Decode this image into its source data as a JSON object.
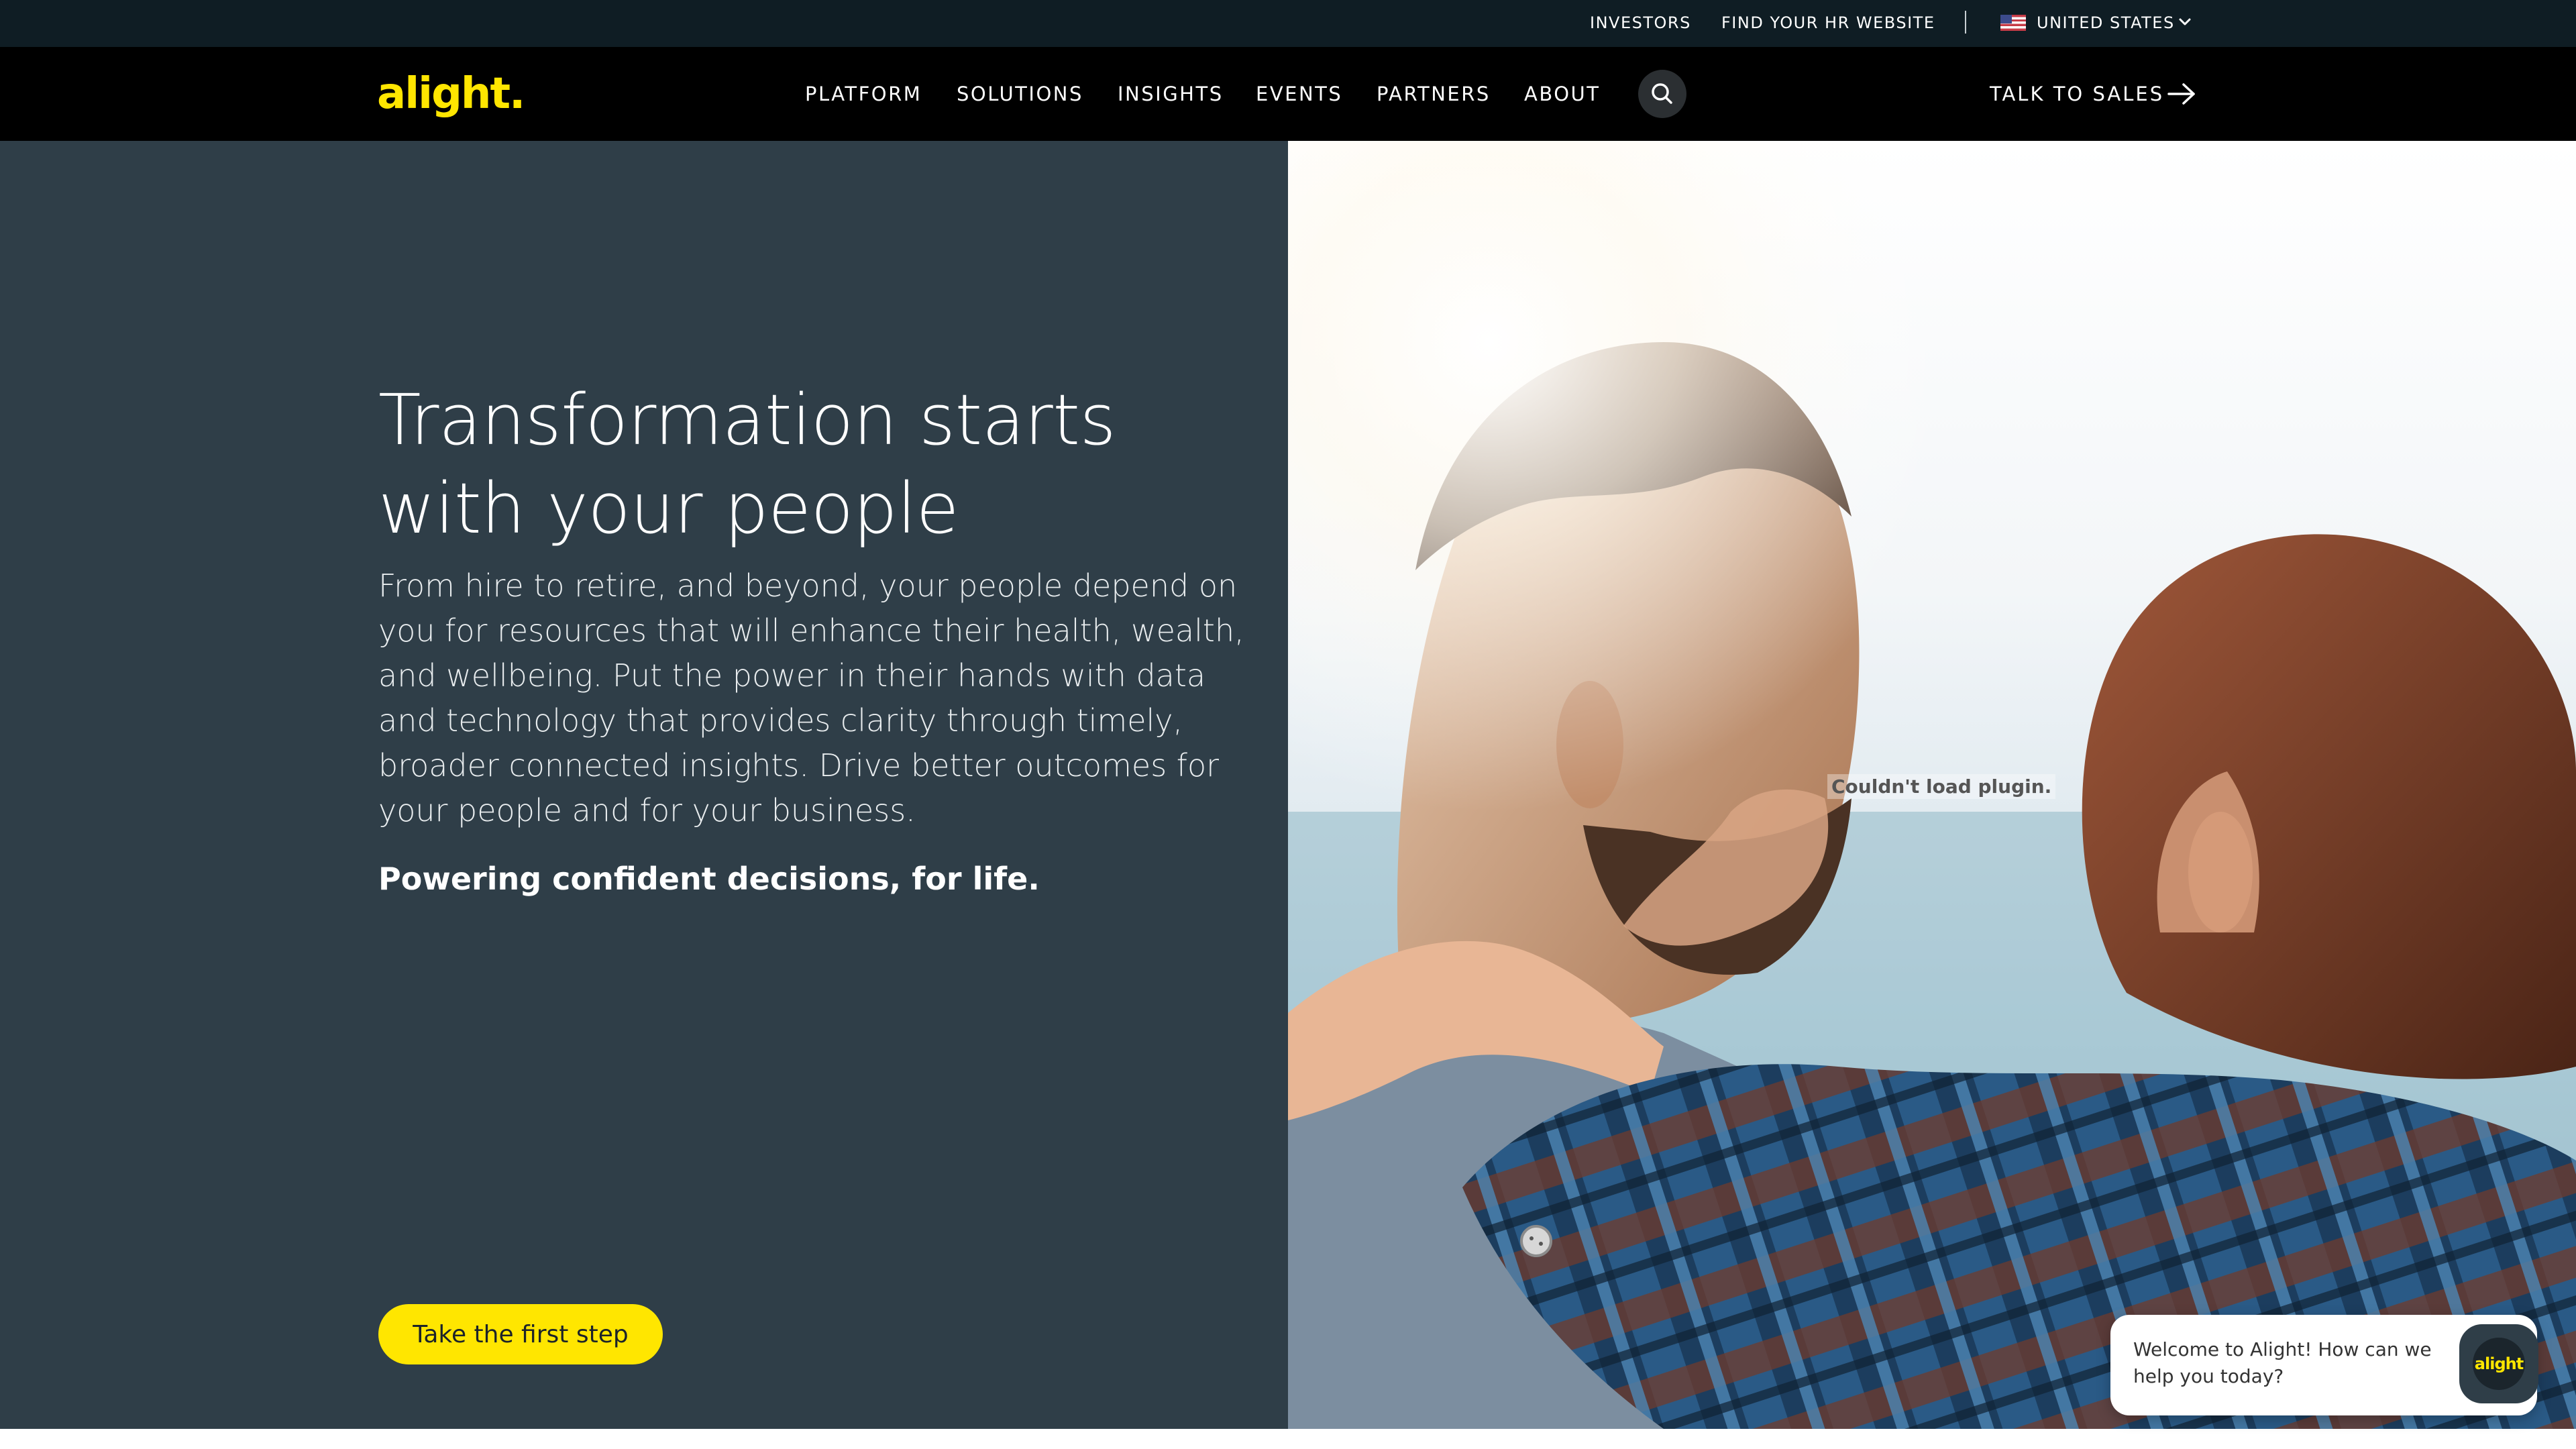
{
  "utility": {
    "investors": "INVESTORS",
    "find_hr": "FIND YOUR HR WEBSITE",
    "separator": "|",
    "country": "UNITED STATES"
  },
  "nav": {
    "logo": "alight.",
    "items": [
      "PLATFORM",
      "SOLUTIONS",
      "INSIGHTS",
      "EVENTS",
      "PARTNERS",
      "ABOUT"
    ],
    "talk_to_sales": "TALK TO SALES"
  },
  "hero": {
    "title_line1": "Transformation starts",
    "title_line2": "with your people",
    "body": "From hire to retire, and beyond, your people depend on you for resources that will enhance their health, wealth, and wellbeing. Put the power in their hands with data and technology that provides clarity through timely, broader connected insights. Drive better outcomes for your people and for your business.",
    "tagline": "Powering confident decisions, for life.",
    "cta": "Take the first step",
    "plugin_message": "Couldn't load plugin."
  },
  "chat": {
    "greeting": "Welcome to Alight! How can we help you today?",
    "avatar_logo": "alight"
  },
  "colors": {
    "brand_yellow": "#ffe600",
    "hero_panel": "#2f3e48",
    "nav_bg": "#000000",
    "utility_bg": "#0f1d24"
  }
}
